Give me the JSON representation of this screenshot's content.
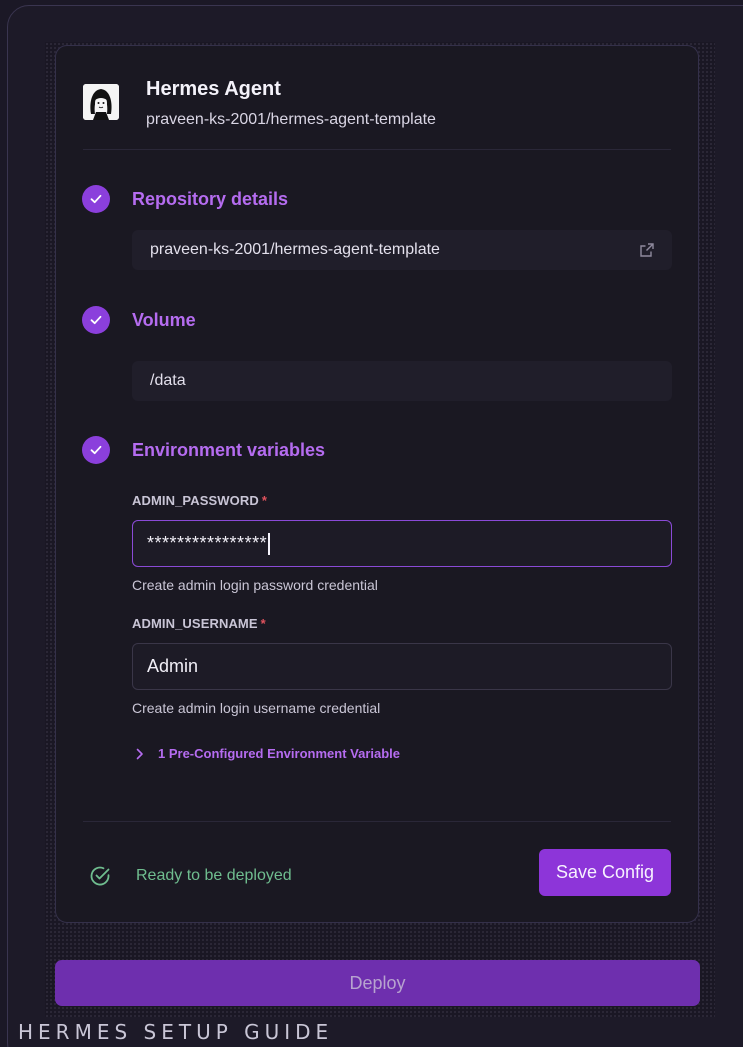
{
  "app": {
    "title": "Hermes Agent",
    "repo_path": "praveen-ks-2001/hermes-agent-template"
  },
  "steps": {
    "repository": {
      "title": "Repository details",
      "value": "praveen-ks-2001/hermes-agent-template"
    },
    "volume": {
      "title": "Volume",
      "value": "/data"
    },
    "env": {
      "title": "Environment variables",
      "variables": [
        {
          "name": "ADMIN_PASSWORD",
          "required_mark": "*",
          "value": "****************",
          "help": "Create admin login password credential"
        },
        {
          "name": "ADMIN_USERNAME",
          "required_mark": "*",
          "value": "Admin",
          "help": "Create admin login username credential"
        }
      ],
      "preconfigured_label": "1 Pre-Configured Environment Variable"
    }
  },
  "status": {
    "text": "Ready to be deployed"
  },
  "buttons": {
    "save_config": "Save Config",
    "deploy": "Deploy"
  },
  "footer": {
    "title": "HERMES SETUP GUIDE"
  },
  "colors": {
    "accent": "#8d35d9",
    "accent_text": "#b56cf0",
    "success": "#6fbd8f",
    "required": "#e0525d"
  }
}
